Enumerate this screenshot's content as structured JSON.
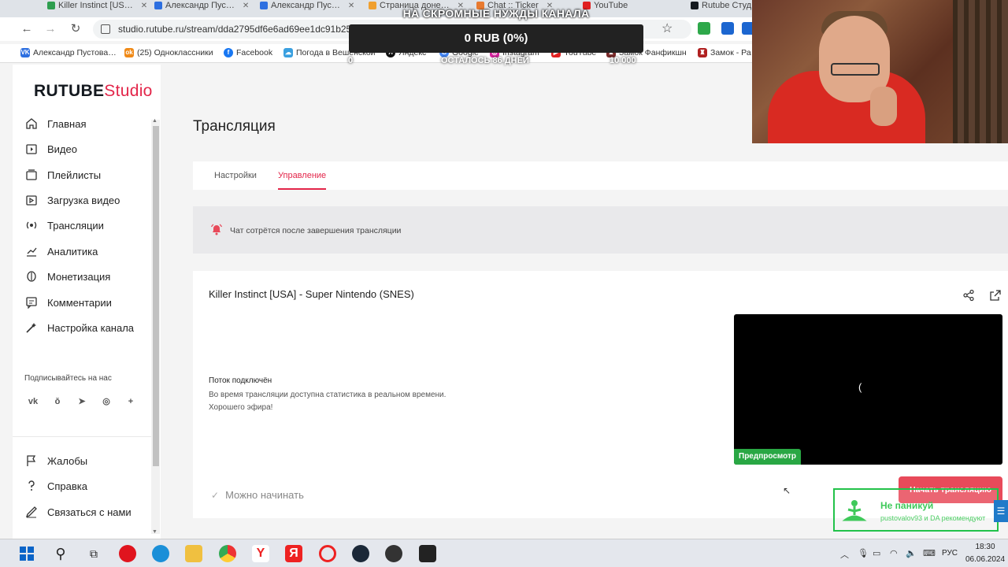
{
  "browser": {
    "tabs": [
      {
        "label": "Killer Instinct [US…",
        "color": "#2e9e4f"
      },
      {
        "label": "Александр Пус…",
        "color": "#2d6fe0"
      },
      {
        "label": "Александр Пус…",
        "color": "#2d6fe0"
      },
      {
        "label": "Страница доне…",
        "color": "#f0a030"
      },
      {
        "label": "Chat :: Ticker",
        "color": "#e87a30"
      },
      {
        "label": "YouTube",
        "color": "#e02020"
      },
      {
        "label": "Rutube Студ…",
        "color": "#14191f"
      }
    ],
    "url": "studio.rutube.ru/stream/dda2795df6e6ad69ee1dc91b25",
    "bookmarks": [
      {
        "label": "Александр Пустова…",
        "icon": "vk-icon",
        "color": "#2d6fe0",
        "glyph": "VK"
      },
      {
        "label": "(25) Одноклассники",
        "icon": "ok-icon",
        "color": "#f08a18",
        "glyph": "ok"
      },
      {
        "label": "Facebook",
        "icon": "facebook-icon",
        "color": "#1877f2",
        "glyph": "f"
      },
      {
        "label": "Погода в Вешенской",
        "icon": "weather-icon",
        "color": "#3aa0e0",
        "glyph": "☁"
      },
      {
        "label": "Яндекс",
        "icon": "yandex-icon",
        "color": "#111",
        "glyph": "Я"
      },
      {
        "label": "Google",
        "icon": "google-icon",
        "color": "#4285f4",
        "glyph": "G"
      },
      {
        "label": "Instagram",
        "icon": "instagram-icon",
        "color": "#d6249f",
        "glyph": "◎"
      },
      {
        "label": "YouTube",
        "icon": "youtube-icon",
        "color": "#e02020",
        "glyph": "▶"
      },
      {
        "label": "Замок Фанфикшн",
        "icon": "castle-icon",
        "color": "#7a2a2a",
        "glyph": "♜"
      },
      {
        "label": "Замок - Ра…",
        "icon": "castle-icon-2",
        "color": "#b02020",
        "glyph": "♜"
      }
    ]
  },
  "donation": {
    "title": "НА СКРОМНЫЕ НУЖДЫ КАНАЛА",
    "amount": "0 RUB (0%)",
    "zero": "0",
    "days_left": "ОСТАЛОСЬ 86 ДНЕЙ",
    "goal": "10 000"
  },
  "sidebar": {
    "logo_main": "RUTUBE",
    "logo_sub": "Studio",
    "items": [
      {
        "label": "Главная",
        "icon": "home-icon"
      },
      {
        "label": "Видео",
        "icon": "video-icon"
      },
      {
        "label": "Плейлисты",
        "icon": "playlist-icon"
      },
      {
        "label": "Загрузка видео",
        "icon": "upload-icon"
      },
      {
        "label": "Трансляции",
        "icon": "broadcast-icon"
      },
      {
        "label": "Аналитика",
        "icon": "analytics-icon"
      },
      {
        "label": "Монетизация",
        "icon": "monetization-icon"
      },
      {
        "label": "Комментарии",
        "icon": "comments-icon"
      },
      {
        "label": "Настройка канала",
        "icon": "channel-settings-icon"
      }
    ],
    "subscribe_label": "Подписывайтесь на нас",
    "socials": [
      "vk-icon",
      "odnoklassniki-icon",
      "telegram-icon",
      "viber-icon",
      "plus-icon"
    ],
    "bottom_items": [
      {
        "label": "Жалобы",
        "icon": "flag-icon"
      },
      {
        "label": "Справка",
        "icon": "help-icon"
      },
      {
        "label": "Связаться с нами",
        "icon": "feedback-icon"
      }
    ]
  },
  "main": {
    "page_title": "Трансляция",
    "tabs": [
      {
        "label": "Настройки",
        "active": false
      },
      {
        "label": "Управление",
        "active": true
      }
    ],
    "notice": "Чат сотрётся после завершения трансляции",
    "stream": {
      "title": "Killer Instinct [USA] - Super Nintendo (SNES)",
      "status_title": "Поток подключён",
      "status_line1": "Во время трансляции доступна статистика в реальном времени.",
      "status_line2": "Хорошего эфира!",
      "preview_label": "Предпросмотр",
      "preview_glyph": "(",
      "ready_label": "Можно начинать",
      "start_button": "Начать трансляцию"
    }
  },
  "panic_overlay": {
    "title": "Не паникуй",
    "subtitle": "pustovalov93 и DA рекомендуют"
  },
  "taskbar": {
    "time": "18:30",
    "date": "06.06.2024",
    "lang": "РУС"
  },
  "colors": {
    "accent": "#e3264a",
    "button": "#e84a5a",
    "preview_label": "#29a744"
  }
}
